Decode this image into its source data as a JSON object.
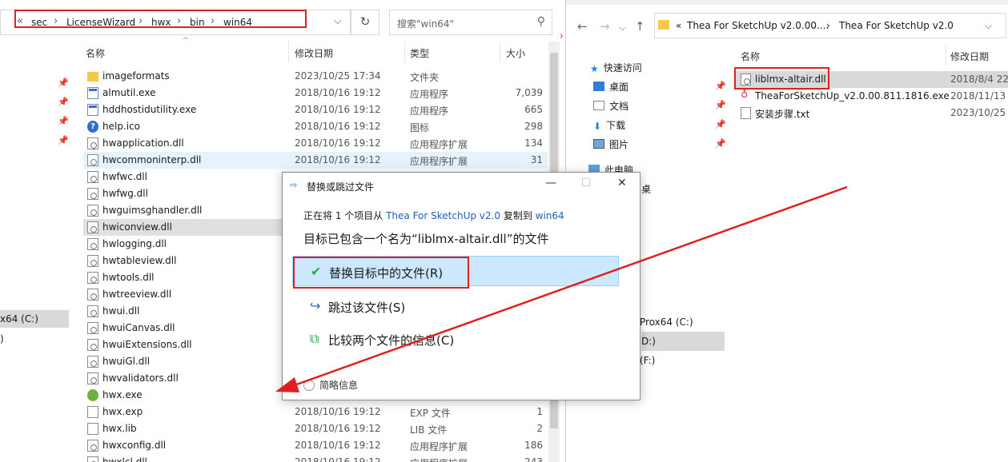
{
  "left": {
    "breadcrumb": [
      "«",
      "sec",
      "LicenseWizard",
      "hwx",
      "bin",
      "win64"
    ],
    "address_dropdown": "⌵",
    "refresh_icon": "↻",
    "search_placeholder": "搜索\"win64\"",
    "columns": {
      "name": "名称",
      "date": "修改日期",
      "type": "类型",
      "size": "大小"
    },
    "nav_drive": "x64 (C:)",
    "nav_drive2": ")",
    "files": [
      {
        "name": "imageformats",
        "date": "2023/10/25 17:34",
        "type": "文件夹",
        "size": "",
        "icon": "folder"
      },
      {
        "name": "almutil.exe",
        "date": "2018/10/16 19:12",
        "type": "应用程序",
        "size": "7,039",
        "icon": "exe"
      },
      {
        "name": "hddhostidutility.exe",
        "date": "2018/10/16 19:12",
        "type": "应用程序",
        "size": "665",
        "icon": "exe"
      },
      {
        "name": "help.ico",
        "date": "2018/10/16 19:12",
        "type": "图标",
        "size": "298",
        "icon": "help"
      },
      {
        "name": "hwapplication.dll",
        "date": "2018/10/16 19:12",
        "type": "应用程序扩展",
        "size": "134",
        "icon": "dll"
      },
      {
        "name": "hwcommoninterp.dll",
        "date": "2018/10/16 19:12",
        "type": "应用程序扩展",
        "size": "31",
        "icon": "dll"
      },
      {
        "name": "hwfwc.dll",
        "date": "",
        "type": "",
        "size": "",
        "icon": "dll"
      },
      {
        "name": "hwfwg.dll",
        "date": "",
        "type": "",
        "size": "",
        "icon": "dll"
      },
      {
        "name": "hwguimsghandler.dll",
        "date": "",
        "type": "",
        "size": "",
        "icon": "dll"
      },
      {
        "name": "hwiconview.dll",
        "date": "",
        "type": "",
        "size": "",
        "icon": "dll"
      },
      {
        "name": "hwlogging.dll",
        "date": "",
        "type": "",
        "size": "",
        "icon": "dll"
      },
      {
        "name": "hwtableview.dll",
        "date": "",
        "type": "",
        "size": "",
        "icon": "dll"
      },
      {
        "name": "hwtools.dll",
        "date": "",
        "type": "",
        "size": "",
        "icon": "dll"
      },
      {
        "name": "hwtreeview.dll",
        "date": "",
        "type": "",
        "size": "",
        "icon": "dll"
      },
      {
        "name": "hwui.dll",
        "date": "",
        "type": "",
        "size": "",
        "icon": "dll"
      },
      {
        "name": "hwuiCanvas.dll",
        "date": "",
        "type": "",
        "size": "",
        "icon": "dll"
      },
      {
        "name": "hwuiExtensions.dll",
        "date": "",
        "type": "",
        "size": "",
        "icon": "dll"
      },
      {
        "name": "hwuiGl.dll",
        "date": "",
        "type": "",
        "size": "",
        "icon": "dll"
      },
      {
        "name": "hwvalidators.dll",
        "date": "",
        "type": "",
        "size": "",
        "icon": "dll"
      },
      {
        "name": "hwx.exe",
        "date": "",
        "type": "",
        "size": "",
        "icon": "hwx"
      },
      {
        "name": "hwx.exp",
        "date": "2018/10/16 19:12",
        "type": "EXP 文件",
        "size": "1",
        "icon": "file"
      },
      {
        "name": "hwx.lib",
        "date": "2018/10/16 19:12",
        "type": "LIB 文件",
        "size": "2",
        "icon": "file"
      },
      {
        "name": "hwxconfig.dll",
        "date": "2018/10/16 19:12",
        "type": "应用程序扩展",
        "size": "186",
        "icon": "dll"
      },
      {
        "name": "hwxlcl.dll",
        "date": "2018/10/16 19:12",
        "type": "应用程序扩展",
        "size": "243",
        "icon": "dll"
      }
    ]
  },
  "right": {
    "back_icon": "←",
    "forward_icon": "→",
    "history_icon": "⌵",
    "up_icon": "↑",
    "breadcrumb": [
      "«",
      "Thea For SketchUp v2.0.00....",
      "›",
      "Thea For SketchUp v2.0"
    ],
    "address_dropdown": "⌵",
    "columns": {
      "name": "名称",
      "date": "修改日期"
    },
    "nav": [
      {
        "label": "快速访问",
        "icon": "star"
      },
      {
        "label": "桌面",
        "icon": "desktop"
      },
      {
        "label": "文档",
        "icon": "doc"
      },
      {
        "label": "下载",
        "icon": "download"
      },
      {
        "label": "图片",
        "icon": "picture"
      },
      {
        "label": "此电脑",
        "icon": "pc"
      }
    ],
    "nav_partial": "桌",
    "drives": [
      "Prox64 (C:)",
      "D:)",
      "(F:)"
    ],
    "files": [
      {
        "name": "liblmx-altair.dll",
        "date": "2018/8/4 22:",
        "icon": "dll"
      },
      {
        "name": "TheaForSketchUp_v2.0.00.811.1816.exe",
        "date": "2018/11/13 2",
        "icon": "thea"
      },
      {
        "name": "安装步骤.txt",
        "date": "2023/10/25 1",
        "icon": "file"
      }
    ]
  },
  "dialog": {
    "title": "替换或跳过文件",
    "minimize": "—",
    "maximize": "☐",
    "close": "✕",
    "line1_prefix": "正在将 1 个项目从",
    "line1_source": "Thea For SketchUp v2.0",
    "line1_mid": "复制到",
    "line1_dest": "win64",
    "line2": "目标已包含一个名为“liblmx-altair.dll”的文件",
    "options": [
      {
        "label": "替换目标中的文件(R)",
        "icon": "✔"
      },
      {
        "label": "跳过该文件(S)",
        "icon": "↪"
      },
      {
        "label": "比较两个文件的信息(C)",
        "icon": "⧉"
      }
    ],
    "more": "简略信息"
  },
  "colors": {
    "highlight_red": "#e02020",
    "selection_blue": "#cce8ff",
    "link_blue": "#1f5fb4",
    "check_green": "#2aa84a"
  }
}
